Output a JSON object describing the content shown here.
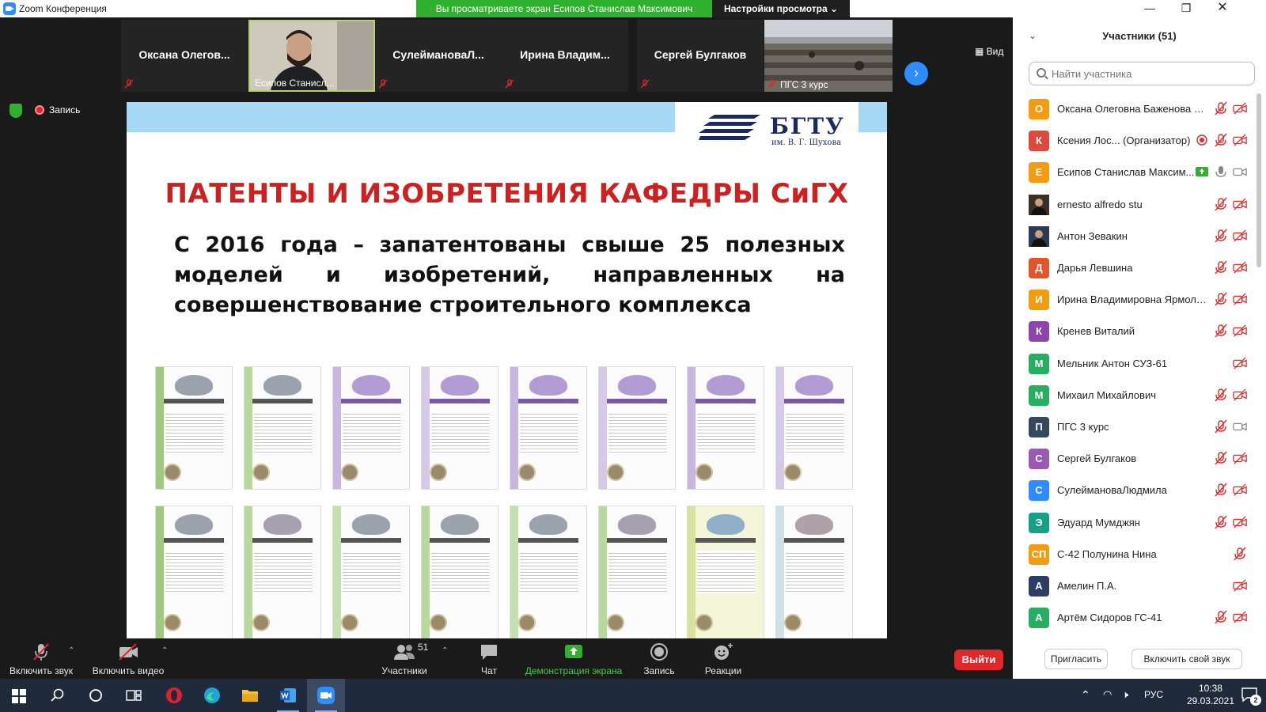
{
  "window": {
    "title": "Zoom Конференция",
    "share_banner": "Вы просматриваете экран Есипов Станислав Максимович",
    "view_settings": "Настройки просмотра",
    "view_button": "Вид",
    "recording": "Запись"
  },
  "thumbnails": [
    {
      "name": "Оксана Олегов..."
    },
    {
      "name": "Есипов Станисл..."
    },
    {
      "name": "СулеймановаЛ..."
    },
    {
      "name": "Ирина Владим..."
    },
    {
      "name": "Сергей Булгаков"
    },
    {
      "name": "ПГС 3 курс"
    }
  ],
  "slide": {
    "logo_text": "БГТУ",
    "logo_sub": "им. В. Г. Шухова",
    "title": "ПАТЕНТЫ И ИЗОБРЕТЕНИЯ КАФЕДРЫ СиГХ",
    "body": "С 2016 года – запатентованы свыше 25 полезных моделей и изобретений, направленных на совершенствование строительного комплекса"
  },
  "participants": {
    "title": "Участники (51)",
    "search_placeholder": "Найти участника",
    "list": [
      {
        "initial": "О",
        "name": "Оксана Олеговна Баженова (Я)",
        "color": "#f39c12"
      },
      {
        "initial": "К",
        "name": "Ксения Лос... (Организатор)",
        "color": "#e0483e"
      },
      {
        "initial": "Е",
        "name": "Есипов Станислав Максим...",
        "color": "#f39c12"
      },
      {
        "initial": "",
        "name": "ernesto alfredo stu",
        "color": "#3a3026"
      },
      {
        "initial": "",
        "name": "Антон Зевакин",
        "color": "#2b3a55"
      },
      {
        "initial": "Д",
        "name": "Дарья Левшина",
        "color": "#e0562a"
      },
      {
        "initial": "И",
        "name": "Ирина Владимировна Ярмоле...",
        "color": "#f39c12"
      },
      {
        "initial": "К",
        "name": "Кренев Виталий",
        "color": "#8e44ad"
      },
      {
        "initial": "М",
        "name": "Мельник Антон СУЗ-61",
        "color": "#27ae60"
      },
      {
        "initial": "М",
        "name": "Михаил Михайлович",
        "color": "#27ae60"
      },
      {
        "initial": "П",
        "name": "ПГС 3 курс",
        "color": "#34495e"
      },
      {
        "initial": "С",
        "name": "Сергей Булгаков",
        "color": "#9b59b6"
      },
      {
        "initial": "С",
        "name": "СулеймановаЛюдмила",
        "color": "#2d8cff"
      },
      {
        "initial": "Э",
        "name": "Эдуард Мумджян",
        "color": "#16a085"
      },
      {
        "initial": "СП",
        "name": "С-42 Полунина Нина",
        "color": "#f39c12"
      },
      {
        "initial": "А",
        "name": "Амелин П.А.",
        "color": "#2c3e66"
      },
      {
        "initial": "А",
        "name": "Артём Сидоров ГС-41",
        "color": "#27ae60"
      }
    ],
    "invite_label": "Пригласить",
    "unmute_label": "Включить свой звук"
  },
  "toolbar": {
    "audio_label": "Включить звук",
    "video_label": "Включить видео",
    "participants_label": "Участники",
    "participants_count": "51",
    "chat_label": "Чат",
    "share_label": "Демонстрация экрана",
    "record_label": "Запись",
    "reactions_label": "Реакции",
    "leave_label": "Выйти"
  },
  "taskbar": {
    "lang": "РУС",
    "time": "10:38",
    "date": "29.03.2021",
    "notifications": "2"
  },
  "colors": {
    "accent": "#2d8cff",
    "share_green": "#2fb12f",
    "leave_red": "#e02828",
    "title_red": "#d01f1f",
    "slide_band": "#a5d9f5"
  }
}
